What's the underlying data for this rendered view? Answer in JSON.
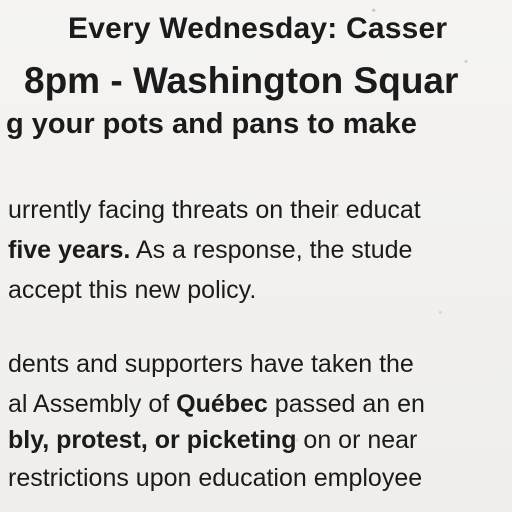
{
  "flyer": {
    "header": {
      "line1": "Every Wednesday: Casser",
      "line2": "8pm - Washington Squar",
      "line3": "g your pots and pans to make"
    },
    "paragraph1": {
      "line1": "urrently facing threats on their educat",
      "line2_bold": "five years.",
      "line2_rest": " As a response, the stude",
      "line3": "accept this new policy."
    },
    "paragraph2": {
      "line1": "dents and supporters have taken the",
      "line2_pre": "al Assembly of ",
      "line2_bold": "Québec",
      "line2_rest": " passed an en",
      "line3_bold": "bly, protest, or picketing",
      "line3_rest": " on or near",
      "line4": "restrictions upon education employee"
    }
  }
}
